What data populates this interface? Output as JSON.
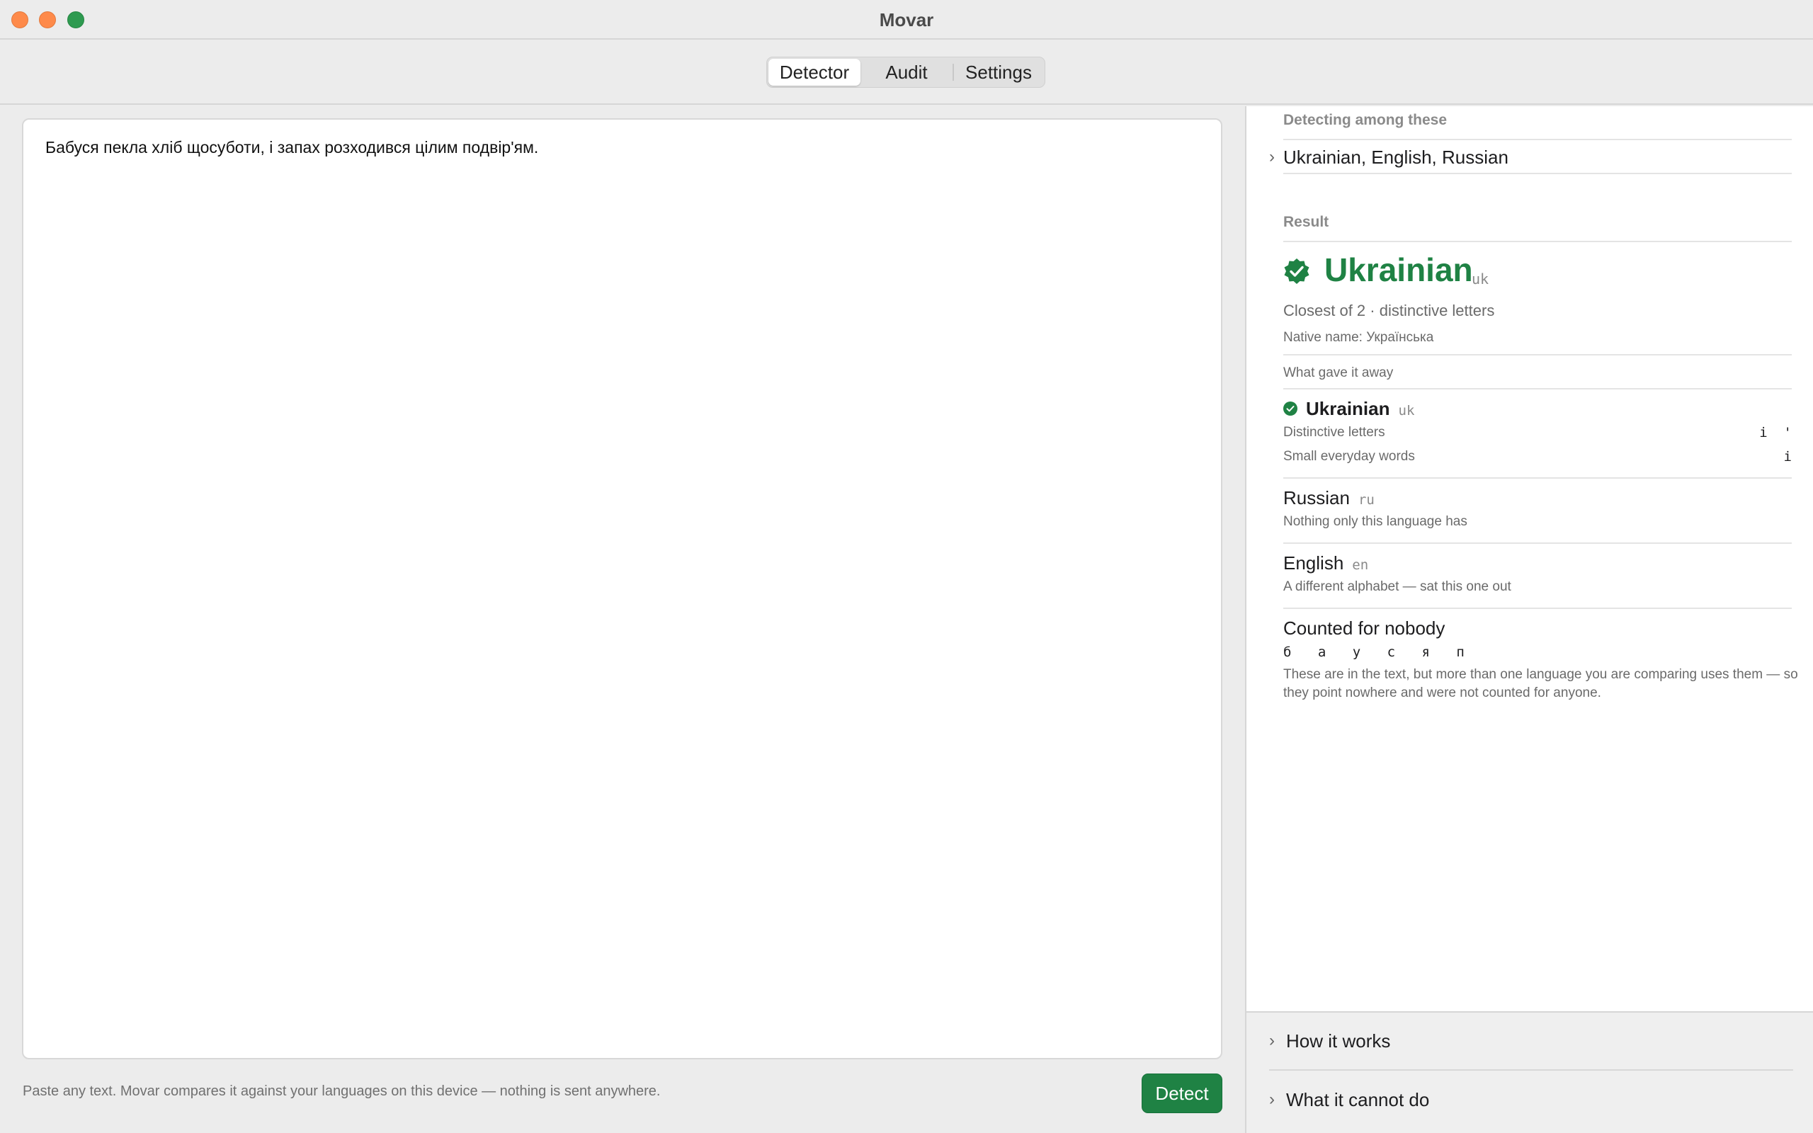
{
  "window": {
    "title": "Movar"
  },
  "tabs": [
    {
      "label": "Detector",
      "active": true
    },
    {
      "label": "Audit",
      "active": false
    },
    {
      "label": "Settings",
      "active": false
    }
  ],
  "editor": {
    "text": "Бабуся пекла хліб щосуботи, і запах розходився цілим подвір'ям."
  },
  "footer": {
    "note": "Paste any text. Movar compares it against your languages on this device — nothing is sent anywhere.",
    "detect_label": "Detect"
  },
  "sidebar": {
    "detecting_heading": "Detecting among these",
    "languages": "Ukrainian, English, Russian",
    "result_heading": "Result",
    "result": {
      "name": "Ukrainian",
      "code": "uk",
      "summary": "Closest of 2 · distinctive letters",
      "native": "Native name: Українська"
    },
    "gave_away_heading": "What gave it away",
    "candidates": [
      {
        "name": "Ukrainian",
        "code": "uk",
        "rows": [
          {
            "label": "Distinctive letters",
            "value": "і  '"
          },
          {
            "label": "Small everyday words",
            "value": "і"
          }
        ]
      },
      {
        "name": "Russian",
        "code": "ru",
        "note": "Nothing only this language has"
      },
      {
        "name": "English",
        "code": "en",
        "note": "A different alphabet — sat this one out"
      }
    ],
    "uncounted": {
      "title": "Counted for nobody",
      "letters": "б а у с я п",
      "explanation": "These are in the text, but more than one language you are comparing uses them — so they point nowhere and were not counted for anyone."
    },
    "disclosures": [
      {
        "label": "How it works"
      },
      {
        "label": "What it cannot do"
      }
    ]
  },
  "colors": {
    "accent_green": "#1f8244",
    "traffic_close": "#fe8a4a",
    "traffic_max": "#2e9a50"
  }
}
